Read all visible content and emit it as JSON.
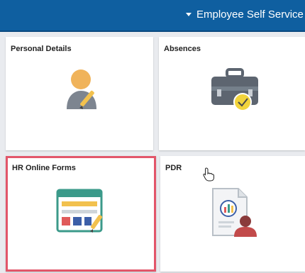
{
  "header": {
    "nav_title": "Employee Self Service"
  },
  "tiles": [
    {
      "title": "Personal Details",
      "icon": "person-icon"
    },
    {
      "title": "Absences",
      "icon": "briefcase-icon"
    },
    {
      "title": "HR Online Forms",
      "icon": "form-icon",
      "selected": true
    },
    {
      "title": "PDR",
      "icon": "report-icon"
    }
  ],
  "colors": {
    "header_bg": "#0f5fa0",
    "selected_border": "#e2566a",
    "page_bg": "#e9ebef"
  }
}
